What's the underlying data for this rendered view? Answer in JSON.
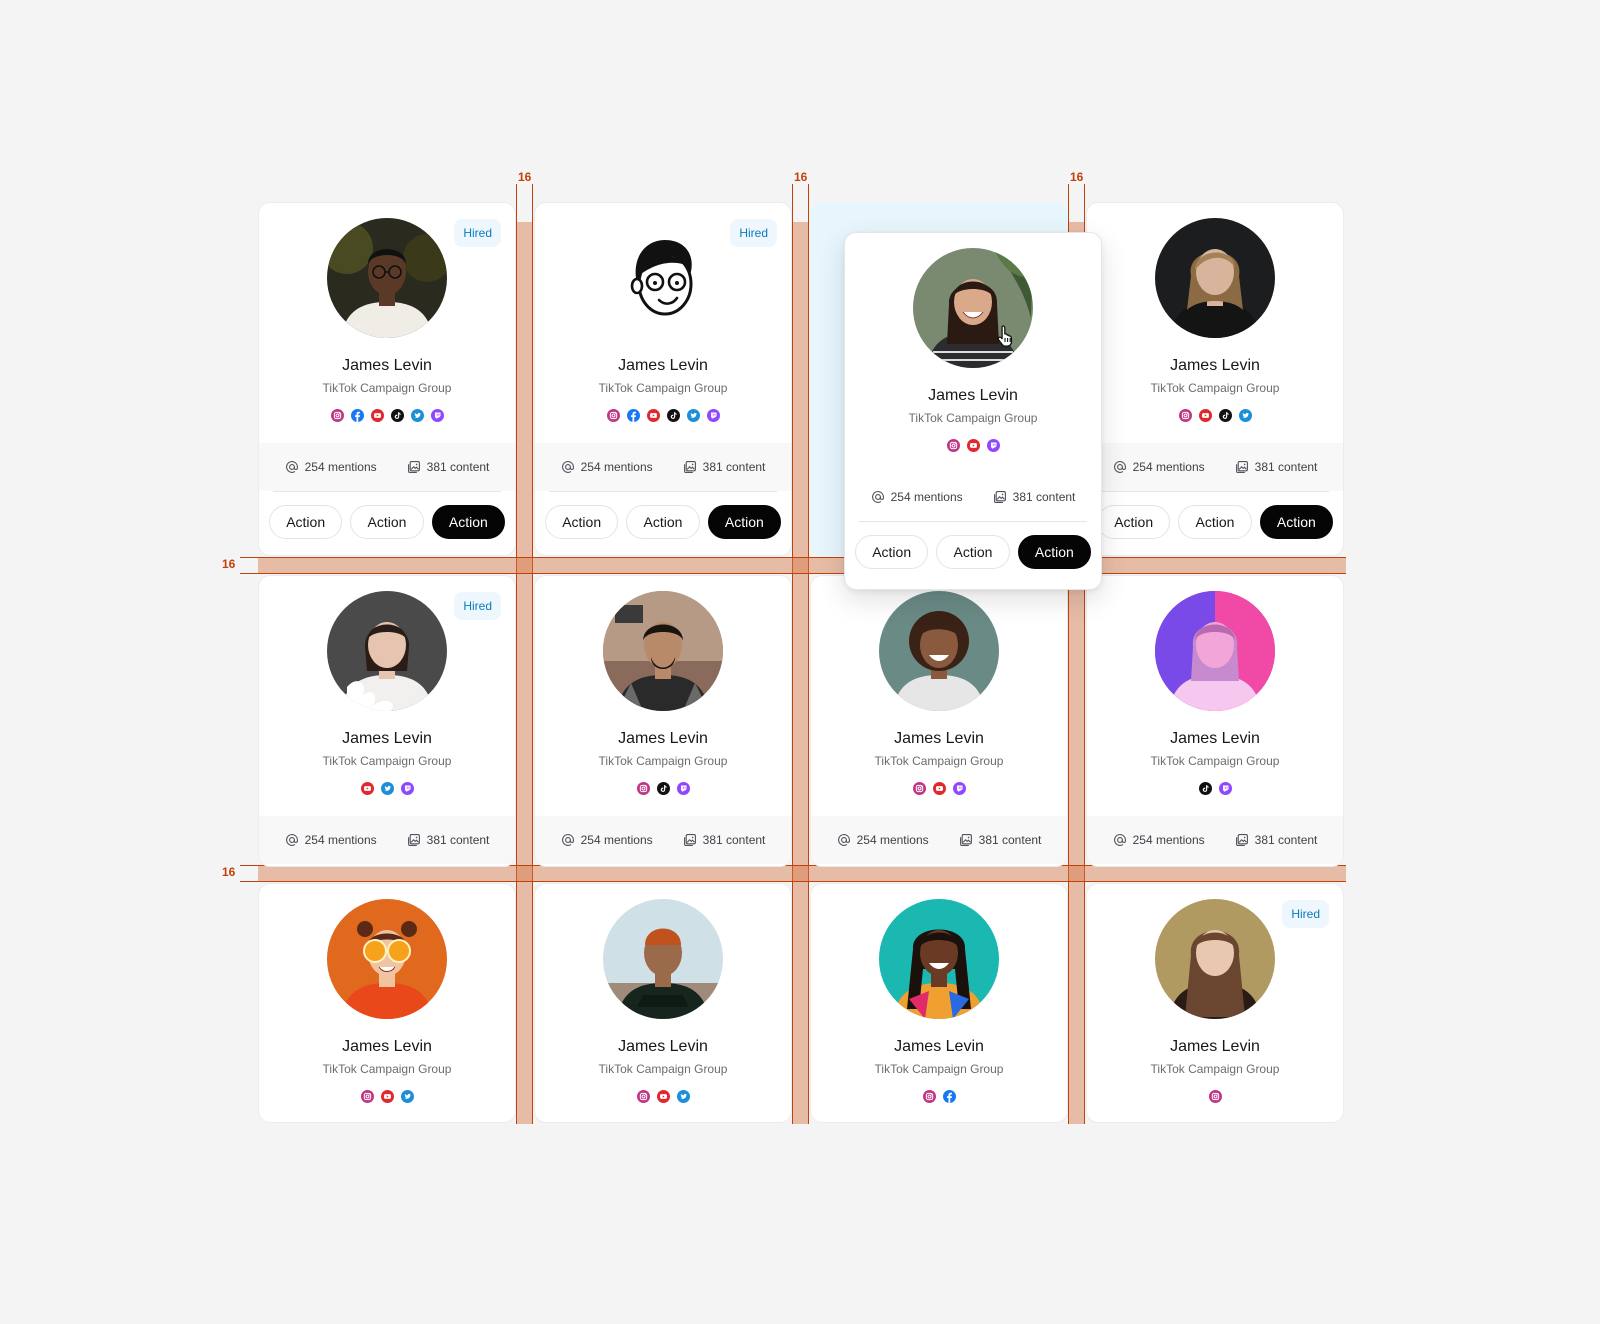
{
  "guides": {
    "gap_label": "16"
  },
  "card": {
    "name": "James Levin",
    "group": "TikTok Campaign Group",
    "mentions": "254 mentions",
    "content": "381 content",
    "hired_label": "Hired",
    "actions": [
      "Action",
      "Action",
      "Action"
    ]
  },
  "social_colors": {
    "instagram": "#c13584",
    "facebook": "#1877f2",
    "youtube": "#e0282e",
    "tiktok": "#111111",
    "twitter": "#1d8fd8",
    "twitch": "#9147ff"
  },
  "cards": [
    {
      "avatar": "man-glasses-photo",
      "hired": true,
      "socials": [
        "instagram",
        "facebook",
        "youtube",
        "tiktok",
        "twitter",
        "twitch"
      ],
      "stats": true,
      "actions": true
    },
    {
      "avatar": "cartoon-illustration",
      "hired": true,
      "socials": [
        "instagram",
        "facebook",
        "youtube",
        "tiktok",
        "twitter",
        "twitch"
      ],
      "stats": true,
      "actions": true
    },
    {
      "avatar": "woman-smiling-plants",
      "hired": false,
      "socials": [
        "instagram",
        "youtube",
        "twitch"
      ],
      "stats": true,
      "actions": true,
      "hover": true
    },
    {
      "avatar": "woman-blonde-dark",
      "hired": false,
      "socials": [
        "instagram",
        "youtube",
        "tiktok",
        "twitter"
      ],
      "stats": true,
      "actions": true
    },
    {
      "avatar": "woman-white-blouse",
      "hired": true,
      "socials": [
        "youtube",
        "twitter",
        "twitch"
      ],
      "stats": true,
      "actions": false
    },
    {
      "avatar": "man-plaid-shirt",
      "hired": false,
      "socials": [
        "instagram",
        "tiktok",
        "twitch"
      ],
      "stats": true,
      "actions": false
    },
    {
      "avatar": "woman-curly-blazer",
      "hired": false,
      "socials": [
        "instagram",
        "youtube",
        "twitch"
      ],
      "stats": true,
      "actions": false
    },
    {
      "avatar": "woman-neon-light",
      "hired": false,
      "socials": [
        "tiktok",
        "twitch"
      ],
      "stats": true,
      "actions": false
    },
    {
      "avatar": "girl-orange-slices",
      "hired": false,
      "socials": [
        "instagram",
        "youtube",
        "twitter"
      ],
      "stats": false,
      "actions": false
    },
    {
      "avatar": "man-beanie-turtleneck",
      "hired": false,
      "socials": [
        "instagram",
        "youtube",
        "twitter"
      ],
      "stats": false,
      "actions": false
    },
    {
      "avatar": "woman-colorful-dress",
      "hired": false,
      "socials": [
        "instagram",
        "facebook"
      ],
      "stats": false,
      "actions": false
    },
    {
      "avatar": "woman-portrait-hair",
      "hired": true,
      "socials": [
        "instagram"
      ],
      "stats": false,
      "actions": false
    }
  ]
}
